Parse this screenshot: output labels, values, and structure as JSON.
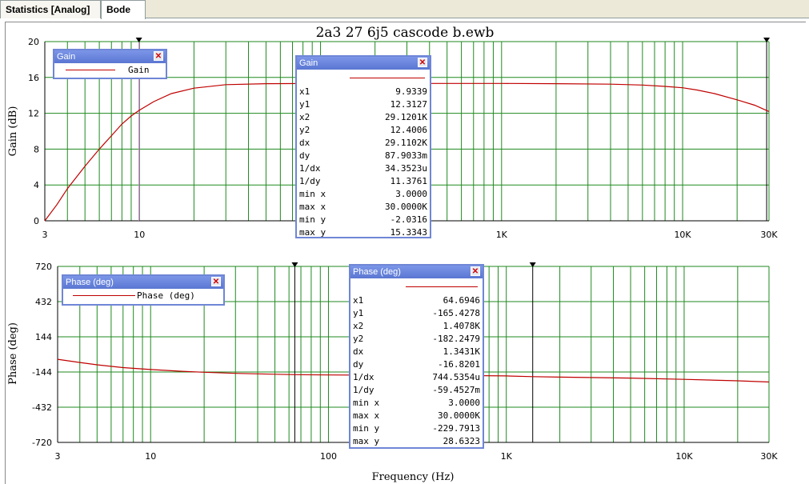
{
  "tabs": [
    {
      "label": "Statistics [Analog]",
      "active": false
    },
    {
      "label": "Bode",
      "active": true
    }
  ],
  "colors": {
    "grid": "#1f8a1f",
    "trace": "#c00000",
    "cursor_gain": "#e070e0",
    "cursor_black": "#000000"
  },
  "chart_data": [
    {
      "type": "line",
      "title": "2a3 27 6j5 cascode b.ewb",
      "xlabel": "",
      "ylabel": "Gain (dB)",
      "xscale": "log",
      "xlim": [
        3,
        30000
      ],
      "ylim": [
        0,
        20
      ],
      "yticks": [
        0,
        4,
        8,
        12,
        16,
        20
      ],
      "ytick_labels": [
        "0",
        "4",
        "8",
        "12",
        "16",
        "20"
      ],
      "xtick_labels": [
        {
          "x": 3,
          "label": "3"
        },
        {
          "x": 10,
          "label": "10"
        },
        {
          "x": 1000,
          "label": "1K"
        },
        {
          "x": 10000,
          "label": "10K"
        },
        {
          "x": 30000,
          "label": "30K"
        }
      ],
      "grid": true,
      "series": [
        {
          "name": "Gain",
          "x": [
            3,
            3.5,
            4,
            5,
            6,
            7,
            8,
            9,
            9.9339,
            12,
            15,
            20,
            30,
            50,
            100,
            200,
            500,
            1000,
            2000,
            4000,
            6000,
            8000,
            10000,
            12000,
            15000,
            20000,
            25000,
            30000
          ],
          "y": [
            -0.2,
            1.8,
            3.6,
            6.1,
            8.0,
            9.5,
            10.8,
            11.7,
            12.3127,
            13.3,
            14.2,
            14.8,
            15.2,
            15.3,
            15.33,
            15.33,
            15.33,
            15.33,
            15.3,
            15.25,
            15.15,
            15.0,
            14.85,
            14.6,
            14.2,
            13.5,
            12.9,
            12.2
          ]
        }
      ],
      "cursors": [
        {
          "x": 9.9339,
          "color": "#e070e0"
        },
        {
          "x": 29120.1,
          "color": "#000000"
        }
      ],
      "legend": {
        "title": "Gain",
        "entries": [
          "Gain"
        ],
        "position": "top-left"
      },
      "cursor_window": {
        "title": "Gain",
        "rows": [
          {
            "k": "x1",
            "v": "9.9339"
          },
          {
            "k": "y1",
            "v": "12.3127"
          },
          {
            "k": "x2",
            "v": "29.1201K"
          },
          {
            "k": "y2",
            "v": "12.4006"
          },
          {
            "k": "dx",
            "v": "29.1102K"
          },
          {
            "k": "dy",
            "v": "87.9033m"
          },
          {
            "k": "1/dx",
            "v": "34.3523u"
          },
          {
            "k": "1/dy",
            "v": "11.3761"
          },
          {
            "k": "min x",
            "v": "3.0000"
          },
          {
            "k": "max x",
            "v": "30.0000K"
          },
          {
            "k": "min y",
            "v": "-2.0316"
          },
          {
            "k": "max y",
            "v": "15.3343"
          }
        ]
      }
    },
    {
      "type": "line",
      "title": "",
      "xlabel": "Frequency (Hz)",
      "ylabel": "Phase (deg)",
      "xscale": "log",
      "xlim": [
        3,
        30000
      ],
      "ylim": [
        -720,
        720
      ],
      "yticks": [
        -720,
        -432,
        -144,
        144,
        432,
        720
      ],
      "ytick_labels": [
        "-720",
        "-432",
        "-144",
        "144",
        "432",
        "720"
      ],
      "xtick_labels": [
        {
          "x": 3,
          "label": "3"
        },
        {
          "x": 10,
          "label": "10"
        },
        {
          "x": 100,
          "label": "100"
        },
        {
          "x": 1000,
          "label": "1K"
        },
        {
          "x": 10000,
          "label": "10K"
        },
        {
          "x": 30000,
          "label": "30K"
        }
      ],
      "grid": true,
      "series": [
        {
          "name": "Phase (deg)",
          "x": [
            3,
            4,
            5,
            7,
            10,
            15,
            20,
            30,
            50,
            64.6946,
            100,
            200,
            500,
            1000,
            1407.8,
            2000,
            5000,
            10000,
            20000,
            30000
          ],
          "y": [
            -40,
            -66,
            -85,
            -108,
            -124,
            -138,
            -146,
            -155,
            -162,
            -165.4278,
            -168,
            -170,
            -172,
            -176,
            -182.2479,
            -186,
            -194,
            -204,
            -216,
            -226
          ]
        }
      ],
      "cursors": [
        {
          "x": 64.6946,
          "color": "#000000"
        },
        {
          "x": 1407.8,
          "color": "#000000"
        }
      ],
      "legend": {
        "title": "Phase (deg)",
        "entries": [
          "Phase (deg)"
        ],
        "position": "top-left"
      },
      "cursor_window": {
        "title": "Phase (deg)",
        "rows": [
          {
            "k": "x1",
            "v": "64.6946"
          },
          {
            "k": "y1",
            "v": "-165.4278"
          },
          {
            "k": "x2",
            "v": "1.4078K"
          },
          {
            "k": "y2",
            "v": "-182.2479"
          },
          {
            "k": "dx",
            "v": "1.3431K"
          },
          {
            "k": "dy",
            "v": "-16.8201"
          },
          {
            "k": "1/dx",
            "v": "744.5354u"
          },
          {
            "k": "1/dy",
            "v": "-59.4527m"
          },
          {
            "k": "min x",
            "v": "3.0000"
          },
          {
            "k": "max x",
            "v": "30.0000K"
          },
          {
            "k": "min y",
            "v": "-229.7913"
          },
          {
            "k": "max y",
            "v": "28.6323"
          }
        ]
      }
    }
  ]
}
